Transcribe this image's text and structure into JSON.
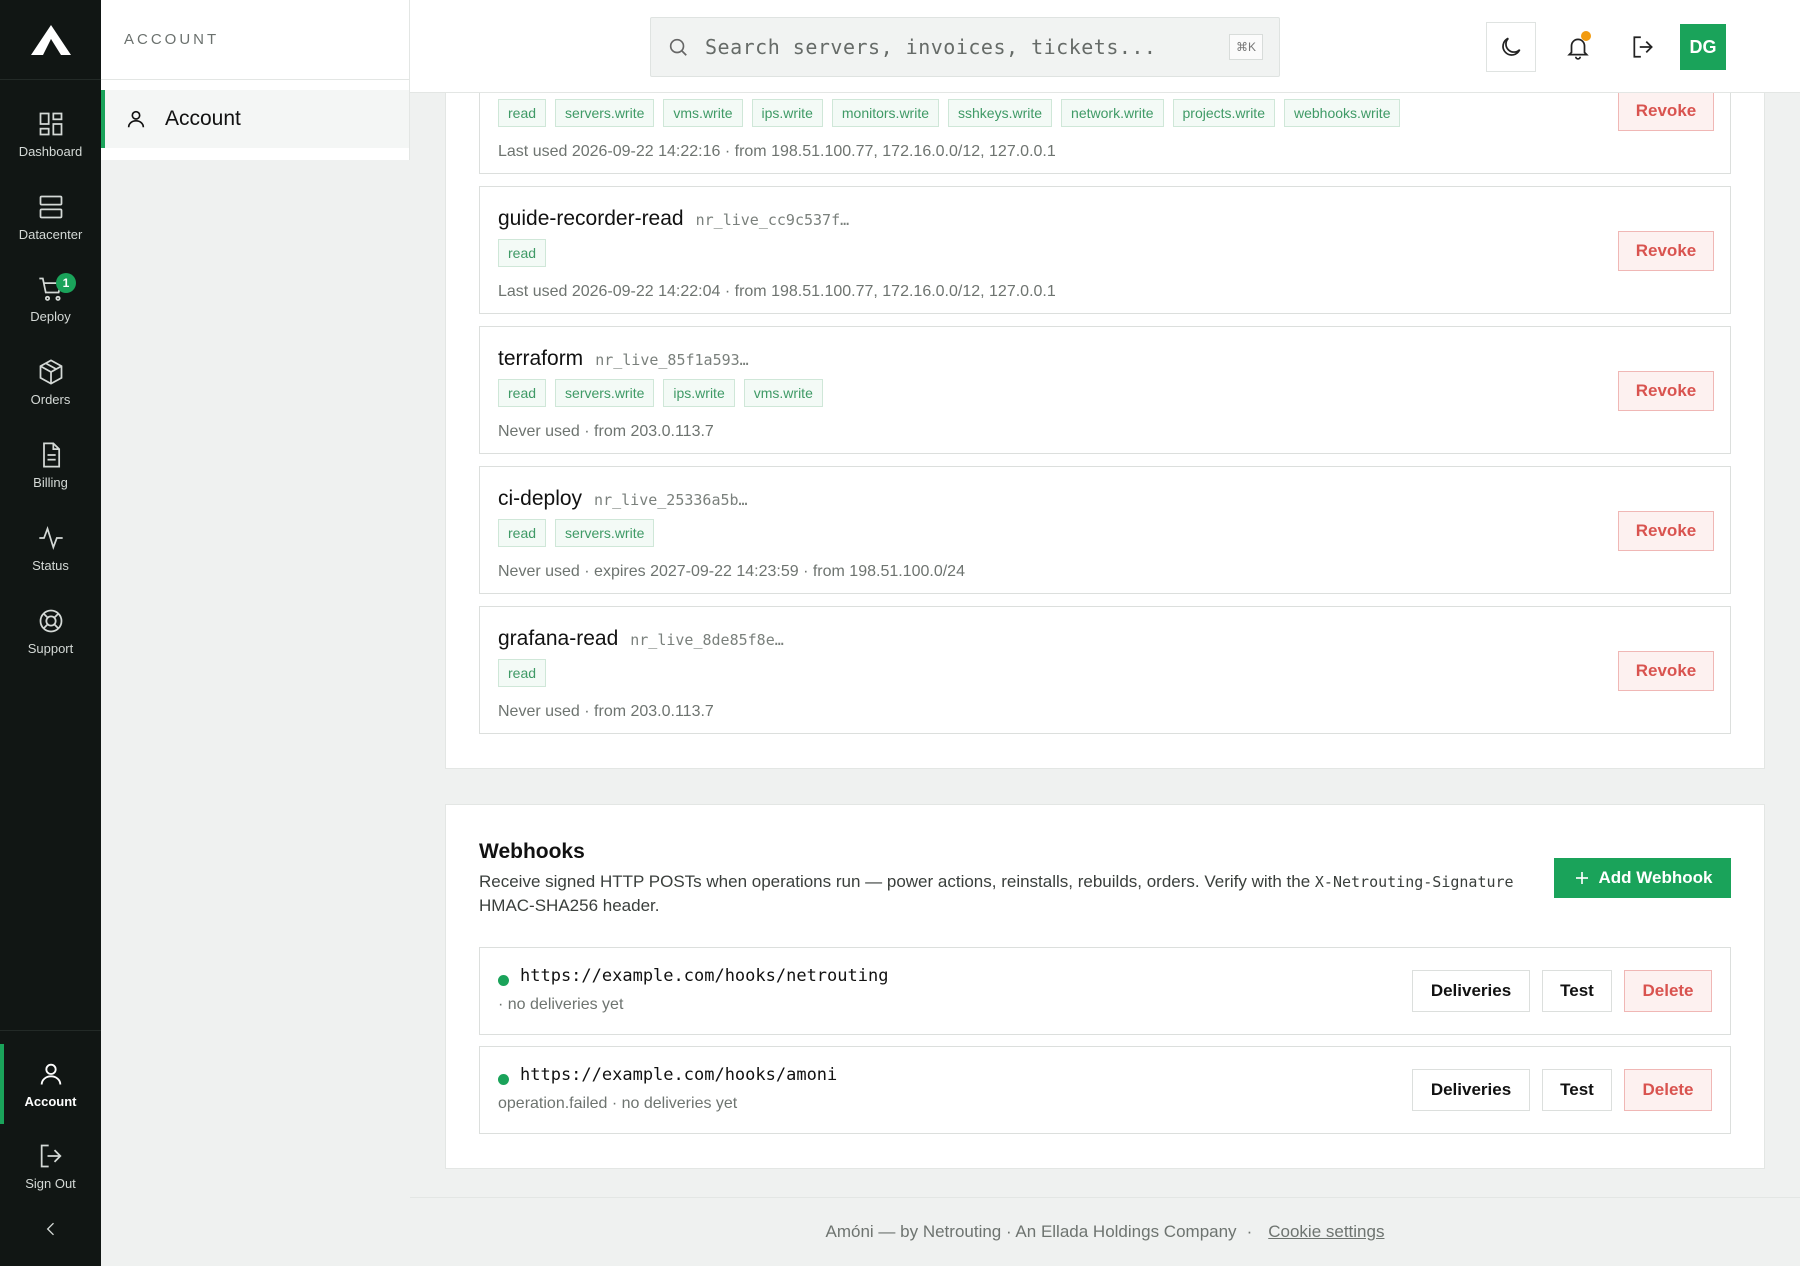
{
  "rail": {
    "items": [
      {
        "label": "Dashboard",
        "icon": "dashboard-icon"
      },
      {
        "label": "Datacenter",
        "icon": "server-icon"
      },
      {
        "label": "Deploy",
        "icon": "cart-icon",
        "badge": "1"
      },
      {
        "label": "Orders",
        "icon": "box-icon"
      },
      {
        "label": "Billing",
        "icon": "document-icon"
      },
      {
        "label": "Status",
        "icon": "activity-icon"
      },
      {
        "label": "Support",
        "icon": "lifebuoy-icon"
      }
    ],
    "account_label": "Account",
    "signout_label": "Sign Out"
  },
  "subnav": {
    "heading": "ACCOUNT",
    "item": "Account"
  },
  "topbar": {
    "search_placeholder": "Search servers, invoices, tickets...",
    "shortcut": "⌘K",
    "avatar": "DG"
  },
  "api_keys": [
    {
      "name": "",
      "prefix": "",
      "scopes": [
        "read",
        "servers.write",
        "vms.write",
        "ips.write",
        "monitors.write",
        "sshkeys.write",
        "network.write",
        "projects.write",
        "webhooks.write"
      ],
      "meta": "Last used 2026-09-22 14:22:16 · from 198.51.100.77, 172.16.0.0/12, 127.0.0.1"
    },
    {
      "name": "guide-recorder-read",
      "prefix": "nr_live_cc9c537f…",
      "scopes": [
        "read"
      ],
      "meta": "Last used 2026-09-22 14:22:04 · from 198.51.100.77, 172.16.0.0/12, 127.0.0.1"
    },
    {
      "name": "terraform",
      "prefix": "nr_live_85f1a593…",
      "scopes": [
        "read",
        "servers.write",
        "ips.write",
        "vms.write"
      ],
      "meta": "Never used · from 203.0.113.7"
    },
    {
      "name": "ci-deploy",
      "prefix": "nr_live_25336a5b…",
      "scopes": [
        "read",
        "servers.write"
      ],
      "meta": "Never used · expires 2027-09-22 14:23:59 · from 198.51.100.0/24"
    },
    {
      "name": "grafana-read",
      "prefix": "nr_live_8de85f8e…",
      "scopes": [
        "read"
      ],
      "meta": "Never used · from 203.0.113.7"
    }
  ],
  "revoke_label": "Revoke",
  "webhooks": {
    "title": "Webhooks",
    "desc_before": "Receive signed HTTP POSTs when operations run — power actions, reinstalls, rebuilds, orders. Verify with the ",
    "desc_code": "X-Netrouting-Signature",
    "desc_after": " HMAC-SHA256 header.",
    "add_label": "Add Webhook",
    "items": [
      {
        "url": "https://example.com/hooks/netrouting",
        "sub": "· no deliveries yet"
      },
      {
        "url": "https://example.com/hooks/amoni",
        "sub": "operation.failed · no deliveries yet"
      }
    ],
    "deliveries_label": "Deliveries",
    "test_label": "Test",
    "delete_label": "Delete"
  },
  "footer": {
    "text": "Amóni — by Netrouting · An Ellada Holdings Company",
    "sep": "·",
    "cookie": "Cookie settings"
  },
  "colors": {
    "accent": "#1aa35a",
    "danger": "#d9534f",
    "rail_bg": "#111614"
  }
}
